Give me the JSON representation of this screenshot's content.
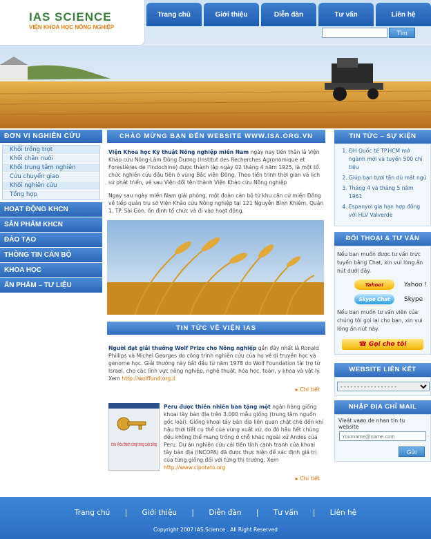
{
  "logo": {
    "title": "IAS SCIENCE",
    "subtitle": "VIỆN KHOA HỌC NÔNG NGHIỆP"
  },
  "topnav": [
    "Trang chủ",
    "Giới thiệu",
    "Diễn đàn",
    "Tư vấn",
    "Liên hệ"
  ],
  "search": {
    "value": "",
    "button": "Tìm"
  },
  "left": {
    "heading": "ĐƠN VỊ NGHIÊN CỨU",
    "subitems": [
      "Khối trồng trọt",
      "Khối chăn nuôi",
      "Khối trung tâm nghiên",
      "Cứu chuyển giao",
      "Khối nghiên cứu",
      "Tổng hợp"
    ],
    "items": [
      "HOẠT ĐỘNG KHCN",
      "SẢN PHẨM KHCN",
      "ĐÀO TẠO",
      "THÔNG TIN CÁN BỘ",
      "KHOA HỌC",
      "ẤN PHẨM – TƯ LIỆU"
    ]
  },
  "center": {
    "welcome": "CHÀO MỪNG BẠN ĐẾN WEBSITE WWW.ISA.ORG.VN",
    "intro_bold": "Viện Khoa học Kỹ thuật Nông nghiệp miền Nam",
    "intro_rest": " ngày nay tiền thân là Viện Khảo cứu Nông-Lâm Đông Dương (Institut des Recherches Agronomique et Forestières de l'Indochine) được thành lập ngày 02 tháng 4 năm 1925, là một tổ chức nghiên cứu đầu tiên ở vùng Bắc viễn Đông. Theo tiến trình thời gian và lịch sử phát triển, về sau Viện đổi tên thành Viện Khảo cứu Nông nghiệp",
    "para2": "Ngay sau ngày miền Nam giải phóng, một đoàn cán bộ từ khu căn cứ miền Đông về tiếp quản trụ sở Viện Khảo cứu Nông nghiệp tại 121 Nguyễn Bỉnh Khiêm, Quận 1, TP. Sài Gòn, ổn định tổ chức và đi vào hoạt động.",
    "news_heading": "TIN TỨC VỀ VIỆN IAS",
    "news": [
      {
        "title": "Người đạt giải thưởng Wolf Prize cho Nông nghiệp",
        "body": " gần đây nhất là Ronald Phillips và Michel Georges do công trình nghiên cứu của họ về di truyền học và genome học. Giải thưởng này bắt đầu từ năm 1978 do Wolf Foundation tài trợ từ Israel, cho các lĩnh vực nông nghiệp, nghệ thuật, hóa học, toán, y khoa và vật lý. Xem ",
        "link": "http://wolffund.org.il",
        "more": "Chi tiết"
      },
      {
        "title": "Peru được thiên nhiên ban tặng một",
        "body": " ngân hàng giống khoai tây bản địa trên 3.000 mẫu giống (trung tâm nguồn gốc loài). Giống khoai tây bản địa liên quan chặt chẽ đến khí hậu thời tiết cụ thể của vùng xuất xứ, do đó hầu hết chúng đều không thể mang trồng ở chỗ khác ngoài xứ Andes của Peru. Dự án nghiên cứu cải tiến tính cạnh tranh của khoai tây bản địa (INCOPA) đã được thực hiện để xác định giá trị của từng giống đối với từng thị trường. Xem ",
        "link": "http://www.cipotato.org",
        "more": "Chi tiết",
        "book_title": "chìa khóa thành công trong cuộc sống"
      }
    ]
  },
  "right": {
    "news_heading": "TIN TỨC – SỰ KIỆN",
    "news": [
      "ĐH Quốc tế TP.HCM mở ngành mới và tuyển 500 chỉ tiêu",
      "Giúp bạn tươi tắn dù mất ngủ",
      "Tháng 4 và tháng 5 năm 1961",
      "Espanyol gia hạn hợp đồng với HLV Valverde"
    ],
    "chat_heading": "ĐỐI THOẠI & TƯ VẤN",
    "chat_text": "Nếu bạn muốn được tư vấn trực tuyến bằng Chat, xin vui lòng ấn nút dưới đây.",
    "yahoo_btn": "Yahoo!",
    "yahoo_label": "Yahoo !",
    "skype_btn": "Skype Chat",
    "skype_label": "Skype",
    "call_text": "Nếu bạn muốn tư vấn viên của chúng tôi gọi lại cho bạn, xin vui lòng ấn nút này.",
    "call_btn": "Gọi cho tôi",
    "links_heading": "WEBSITE LIÊN KẾT",
    "links_select": "- - - - - - - - - - - - - - - - -",
    "email_heading": "NHẬP ĐỊA CHỈ MAIL",
    "email_label": "Vieát vaøo de nhan tin tu website",
    "email_placeholder": "Yourname@name.com",
    "email_btn": "Gửi"
  },
  "footer": {
    "nav": [
      "Trang chủ",
      "Giới thiệu",
      "Diễn đàn",
      "Tư vấn",
      "Liên hệ"
    ],
    "separator": "|",
    "copyright": "Copyright  2007 IAS.Science . All Right Reserved"
  }
}
